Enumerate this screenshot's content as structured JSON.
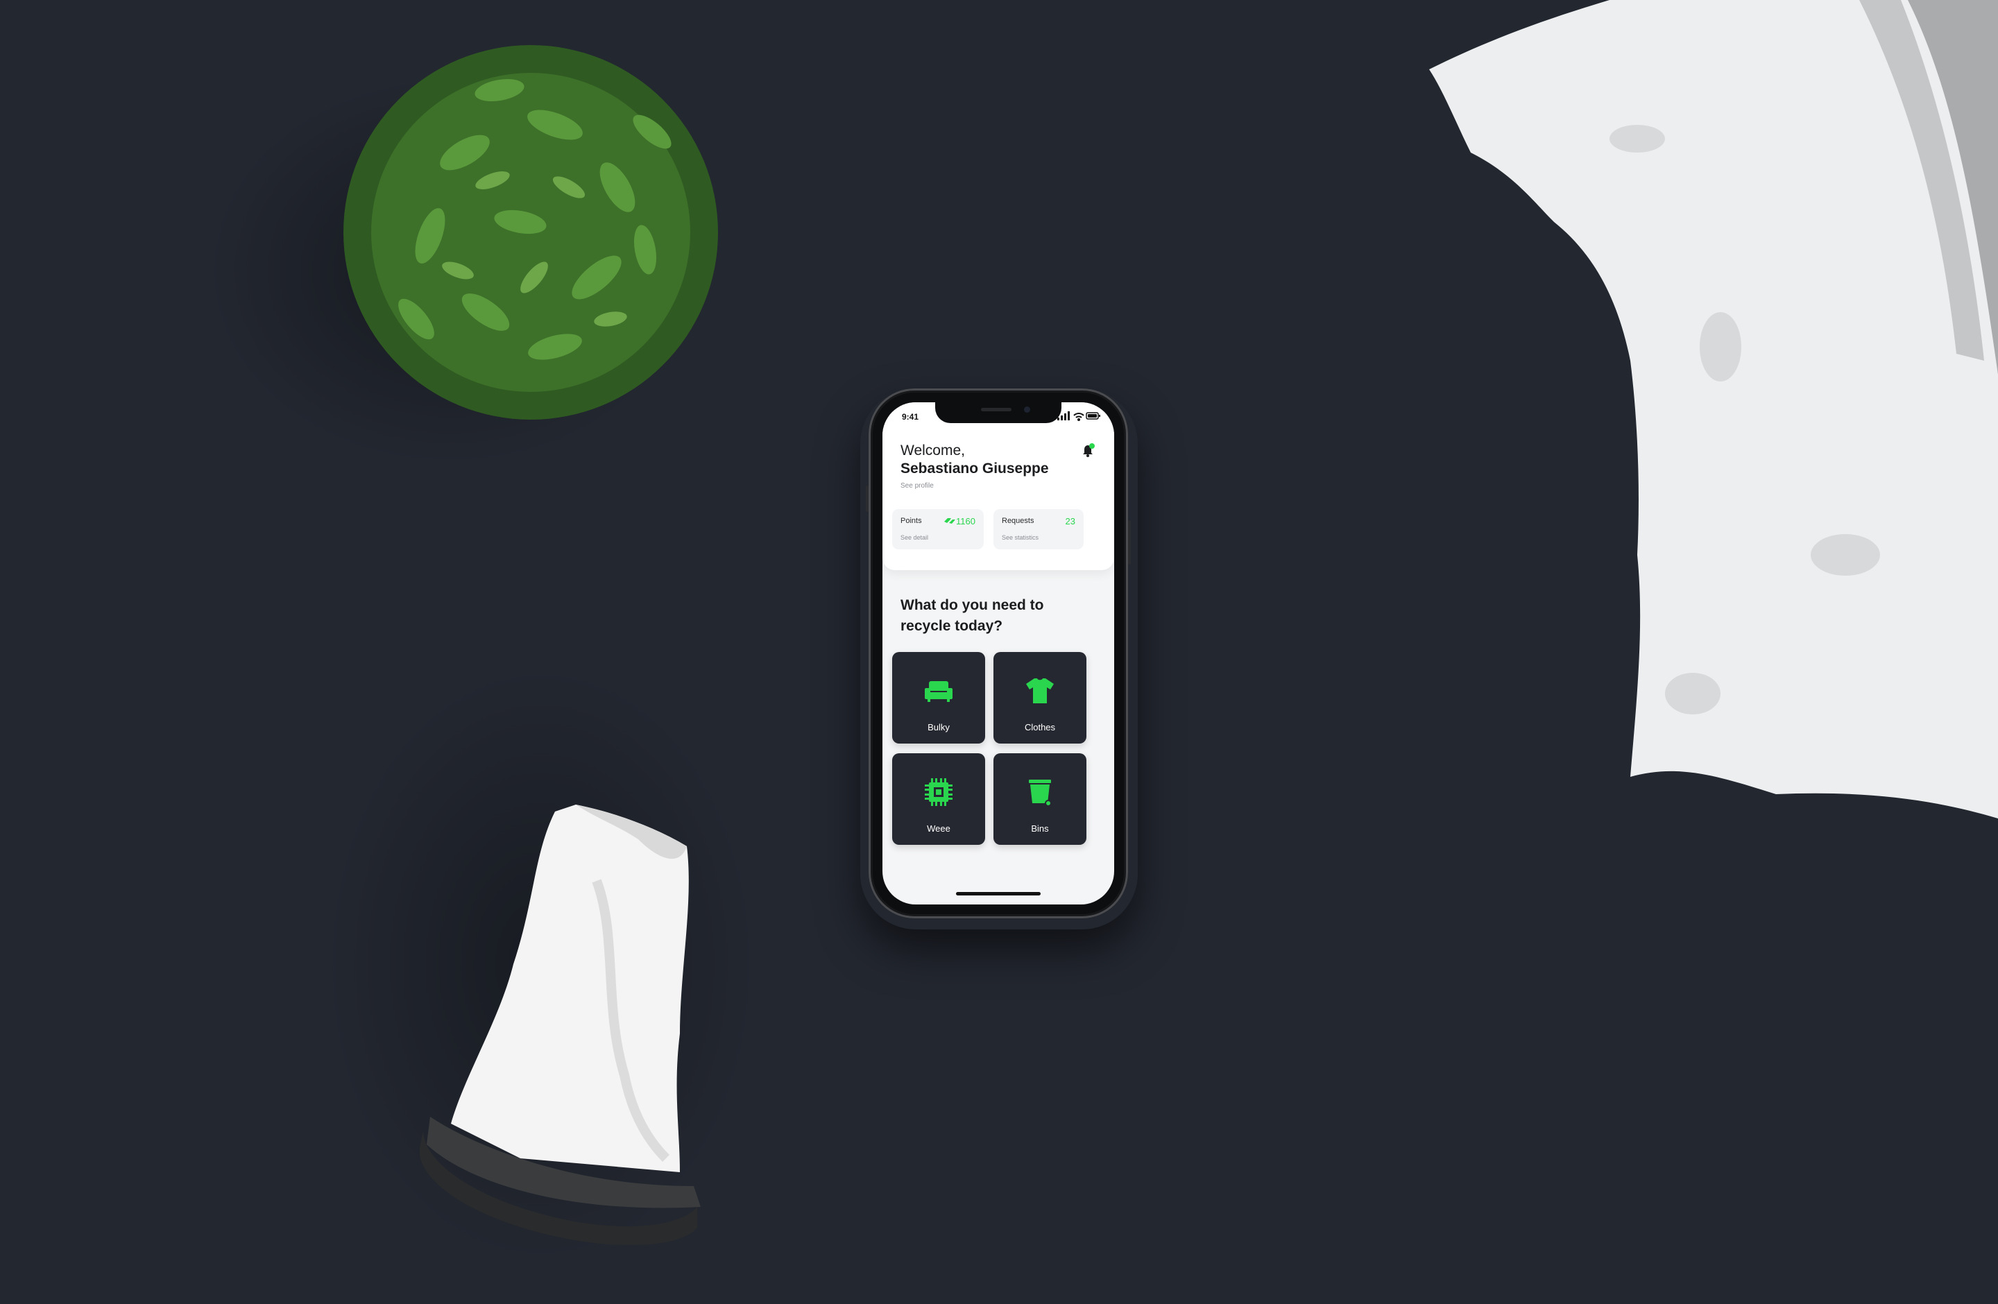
{
  "status_bar": {
    "time": "9:41"
  },
  "header": {
    "greeting": "Welcome,",
    "user_name": "Sebastiano Giuseppe",
    "profile_link": "See profile",
    "notification_badge_color": "#2bd64f"
  },
  "stats": {
    "points": {
      "label": "Points",
      "value": "1160",
      "link": "See detail"
    },
    "requests": {
      "label": "Requests",
      "value": "23",
      "link": "See statistics"
    }
  },
  "main": {
    "question": "What do you need to recycle today?",
    "categories": [
      {
        "label": "Bulky",
        "icon": "sofa-icon"
      },
      {
        "label": "Clothes",
        "icon": "tshirt-icon"
      },
      {
        "label": "Weee",
        "icon": "chip-icon"
      },
      {
        "label": "Bins",
        "icon": "bin-icon"
      }
    ]
  },
  "colors": {
    "accent": "#2bd64f",
    "tile": "#252830",
    "background": "#232730"
  }
}
